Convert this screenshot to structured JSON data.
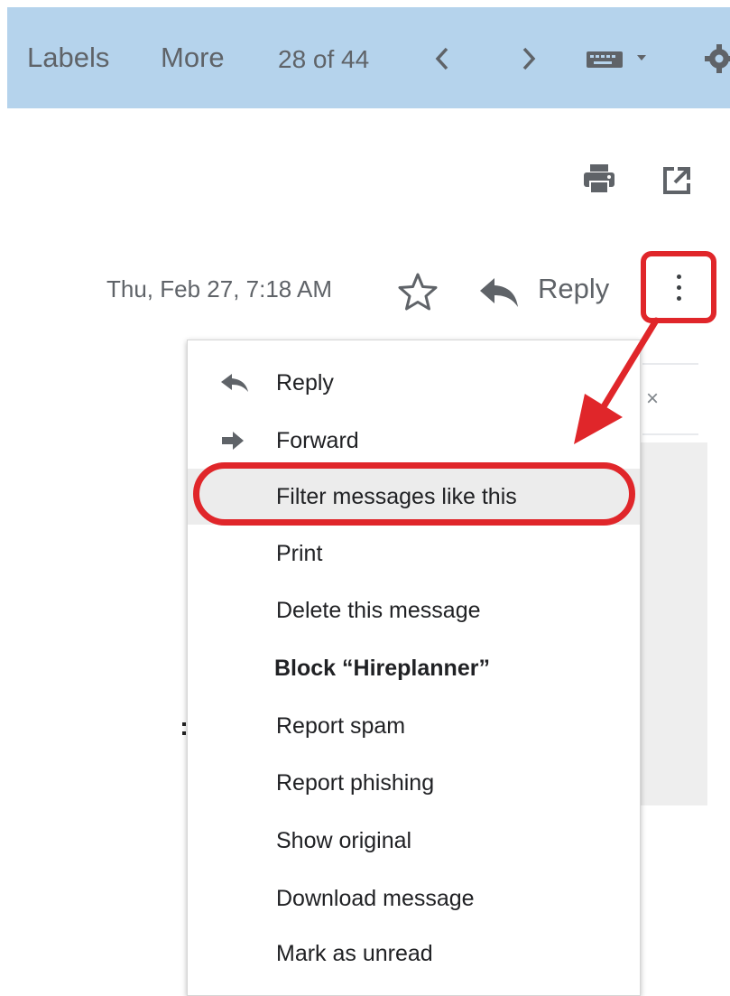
{
  "toolbar": {
    "labels": "Labels",
    "more": "More",
    "count": "28 of 44",
    "icons": [
      "chevron-left-icon",
      "chevron-right-icon",
      "keyboard-icon",
      "dropdown-caret-icon",
      "gear-icon"
    ]
  },
  "header": {
    "icons": [
      "print-icon",
      "open-in-new-window-icon"
    ]
  },
  "message": {
    "date": "Thu, Feb 27, 7:18 AM",
    "reply_label": "Reply"
  },
  "menu": {
    "items": [
      {
        "label": "Reply",
        "icon": "reply-icon"
      },
      {
        "label": "Forward",
        "icon": "forward-icon"
      },
      {
        "label": "Filter messages like this",
        "icon": ""
      },
      {
        "label": "Print",
        "icon": ""
      },
      {
        "label": "Delete this message",
        "icon": ""
      },
      {
        "label": "Block “Hireplanner”",
        "icon": ""
      },
      {
        "label": "Report spam",
        "icon": ""
      },
      {
        "label": "Report phishing",
        "icon": ""
      },
      {
        "label": "Show original",
        "icon": ""
      },
      {
        "label": "Download message",
        "icon": ""
      },
      {
        "label": "Mark as unread",
        "icon": ""
      }
    ]
  },
  "background": {
    "close_symbol": "×"
  },
  "colors": {
    "toolbar_bg": "#b5d3ec",
    "annotation_red": "#e0262a",
    "highlight_row": "#ececec"
  }
}
